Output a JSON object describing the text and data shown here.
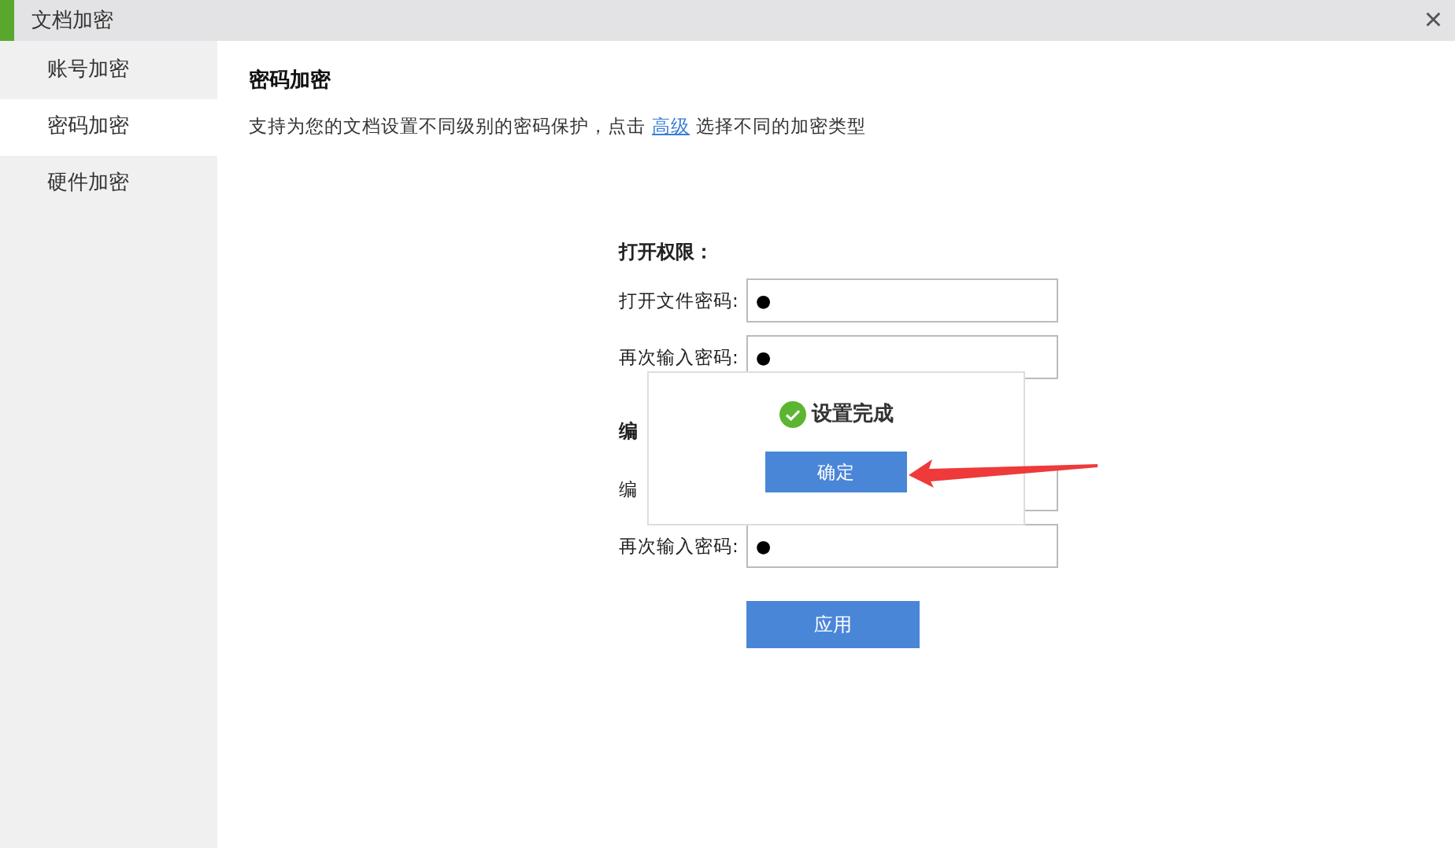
{
  "window": {
    "title": "文档加密",
    "close": "×"
  },
  "sidebar": {
    "items": [
      {
        "label": "账号加密",
        "selected": false
      },
      {
        "label": "密码加密",
        "selected": true
      },
      {
        "label": "硬件加密",
        "selected": false
      }
    ]
  },
  "content": {
    "title": "密码加密",
    "description_before": "支持为您的文档设置不同级别的密码保护，点击",
    "link": "高级",
    "description_after": "选择不同的加密类型"
  },
  "form": {
    "sections": [
      {
        "title": "打开权限：",
        "rows": [
          {
            "label": "打开文件密码:",
            "value": "●"
          },
          {
            "label": "再次输入密码:",
            "value": "●"
          }
        ]
      },
      {
        "title": "编",
        "rows": [
          {
            "label": "编"
          },
          {
            "label": "再次输入密码:",
            "value": "●"
          }
        ]
      }
    ],
    "apply": "应用"
  },
  "dialog": {
    "message": "设置完成",
    "button": "确定"
  }
}
